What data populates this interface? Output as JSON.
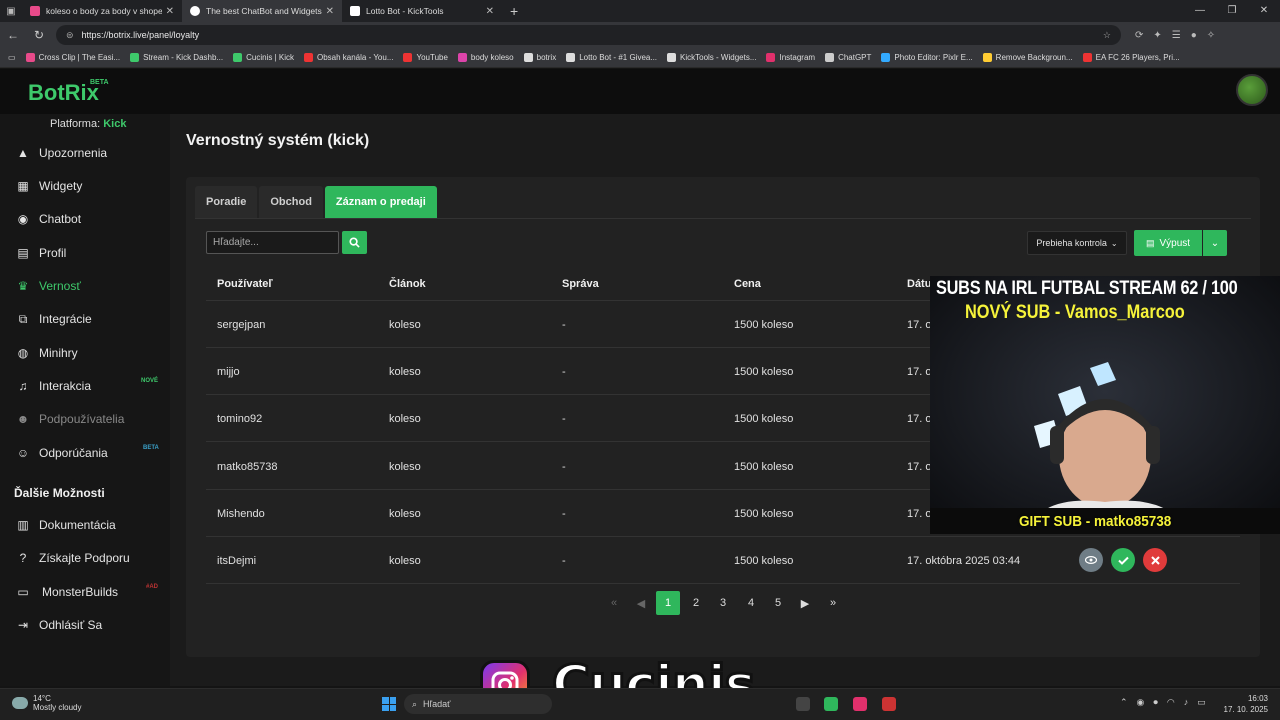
{
  "browser": {
    "tabs": [
      {
        "title": "koleso o body za body v shope",
        "color": "#e84a8a",
        "active": false
      },
      {
        "title": "The best ChatBot and Widgets fo",
        "color": "#ffffff",
        "active": true
      },
      {
        "title": "Lotto Bot - KickTools",
        "color": "#ffffff",
        "active": false
      }
    ],
    "url": "https://botrix.live/panel/loyalty",
    "bookmarks": [
      {
        "label": "Cross Clip | The Easi...",
        "color": "#e84a8a"
      },
      {
        "label": "Stream - Kick Dashb...",
        "color": "#3ec96b"
      },
      {
        "label": "Cucinis | Kick",
        "color": "#3ec96b"
      },
      {
        "label": "Obsah kanála - You...",
        "color": "#e33"
      },
      {
        "label": "YouTube",
        "color": "#e33"
      },
      {
        "label": "body koleso",
        "color": "#d4a"
      },
      {
        "label": "botrix",
        "color": "#ddd"
      },
      {
        "label": "Lotto Bot - #1 Givea...",
        "color": "#ddd"
      },
      {
        "label": "KickTools - Widgets...",
        "color": "#ddd"
      },
      {
        "label": "Instagram",
        "color": "#e1306c"
      },
      {
        "label": "ChatGPT",
        "color": "#ccc"
      },
      {
        "label": "Photo Editor: Pixlr E...",
        "color": "#3af"
      },
      {
        "label": "Remove Backgroun...",
        "color": "#fc3"
      },
      {
        "label": "EA FC 26 Players, Pri...",
        "color": "#e33"
      }
    ]
  },
  "app": {
    "logo": "BotRix",
    "beta": "BETA",
    "platform_label": "Platforma:",
    "platform_value": "Kick"
  },
  "sidebar": {
    "items": [
      {
        "label": "Upozornenia",
        "icon": "warning-icon"
      },
      {
        "label": "Widgety",
        "icon": "grid-icon"
      },
      {
        "label": "Chatbot",
        "icon": "robot-icon"
      },
      {
        "label": "Profil",
        "icon": "id-card-icon"
      },
      {
        "label": "Vernosť",
        "icon": "trophy-icon"
      },
      {
        "label": "Integrácie",
        "icon": "integration-icon"
      },
      {
        "label": "Minihry",
        "icon": "gamepad-icon"
      },
      {
        "label": "Interakcia",
        "icon": "music-icon",
        "badge": "NOVÉ"
      },
      {
        "label": "Podpoužívatelia",
        "icon": "users-icon"
      },
      {
        "label": "Odporúčania",
        "icon": "referral-icon",
        "badge": "BETA"
      }
    ],
    "section_title": "Ďalšie Možnosti",
    "extra_items": [
      {
        "label": "Dokumentácia",
        "icon": "book-icon"
      },
      {
        "label": "Získajte Podporu",
        "icon": "help-icon"
      },
      {
        "label": "MonsterBuilds",
        "icon": "monitor-icon",
        "badge": "#AD"
      },
      {
        "label": "Odhlásiť Sa",
        "icon": "logout-icon"
      }
    ]
  },
  "main": {
    "title": "Vernostný systém (kick)",
    "tabs": [
      "Poradie",
      "Obchod",
      "Záznam o predaji"
    ],
    "search_placeholder": "Hľadajte...",
    "filter_label": "Prebieha kontrola",
    "export_label": "Výpust",
    "columns": [
      "Používateľ",
      "Článok",
      "Správa",
      "Cena",
      "Dátu"
    ],
    "rows": [
      {
        "user": "sergejpan",
        "item": "koleso",
        "message": "-",
        "price": "1500 koleso",
        "date": "17. ok"
      },
      {
        "user": "mijjo",
        "item": "koleso",
        "message": "-",
        "price": "1500 koleso",
        "date": "17. ok"
      },
      {
        "user": "tomino92",
        "item": "koleso",
        "message": "-",
        "price": "1500 koleso",
        "date": "17. ok"
      },
      {
        "user": "matko85738",
        "item": "koleso",
        "message": "-",
        "price": "1500 koleso",
        "date": "17. ok"
      },
      {
        "user": "Mishendo",
        "item": "koleso",
        "message": "-",
        "price": "1500 koleso",
        "date": "17. ok"
      },
      {
        "user": "itsDejmi",
        "item": "koleso",
        "message": "-",
        "price": "1500 koleso",
        "date": "17. októbra 2025 03:44"
      }
    ],
    "pages": [
      "1",
      "2",
      "3",
      "4",
      "5"
    ],
    "active_page": "1"
  },
  "overlay": {
    "title": "SUBS NA IRL FUTBAL STREAM  62 / 100",
    "new_sub": "NOVÝ SUB - Vamos_Marcoo",
    "gift_sub": "GIFT SUB - matko85738",
    "brand": "Cucinis"
  },
  "taskbar": {
    "temp": "14°C",
    "weather": "Mostly cloudy",
    "search": "Hľadať",
    "time": "16:03",
    "date": "17. 10. 2025"
  }
}
